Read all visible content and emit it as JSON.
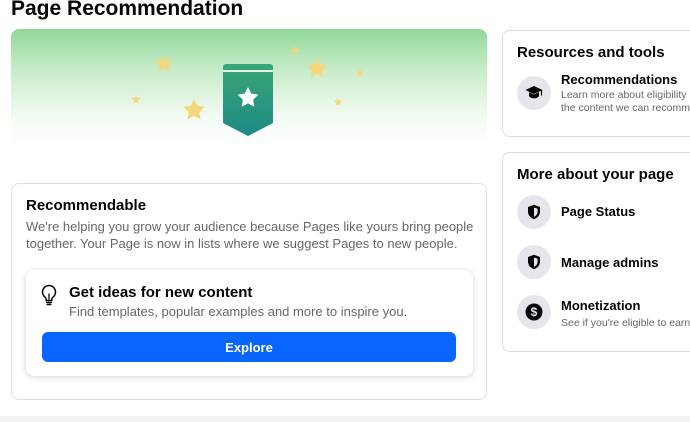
{
  "page": {
    "title": "Page Recommendation"
  },
  "recommendable": {
    "title": "Recommendable",
    "description_line1": "We're helping you grow your audience because Pages like yours bring people",
    "description_line2": "together. Your Page is now in lists where we suggest Pages to new people."
  },
  "ideas": {
    "title": "Get ideas for new content",
    "description": "Find templates, popular examples and more to inspire you.",
    "button_label": "Explore"
  },
  "resources": {
    "title": "Resources and tools",
    "items": [
      {
        "label": "Recommendations",
        "sub_line1": "Learn more about eligibility",
        "sub_line2": "the content we can recomm",
        "icon": "graduation-cap-icon"
      }
    ]
  },
  "more": {
    "title": "More about your page",
    "items": [
      {
        "label": "Page Status",
        "icon": "shield-icon"
      },
      {
        "label": "Manage admins",
        "icon": "shield-icon"
      },
      {
        "label": "Monetization",
        "sub": "See if you're eligible to earn",
        "icon": "dollar-icon"
      }
    ]
  },
  "colors": {
    "primary_button": "#0866ff",
    "badge_top": "#3aa676",
    "badge_bottom": "#1e8a86",
    "star": "#f5d67a"
  }
}
